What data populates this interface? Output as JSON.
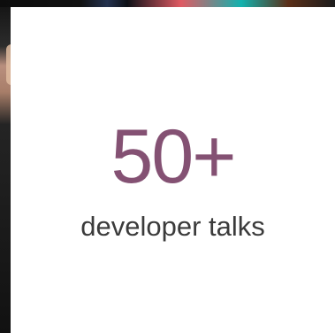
{
  "stats": {
    "count": "50+",
    "label": "developer talks"
  },
  "colors": {
    "accent": "#845173",
    "text": "#3b3b3b",
    "card_background": "#ffffff"
  }
}
